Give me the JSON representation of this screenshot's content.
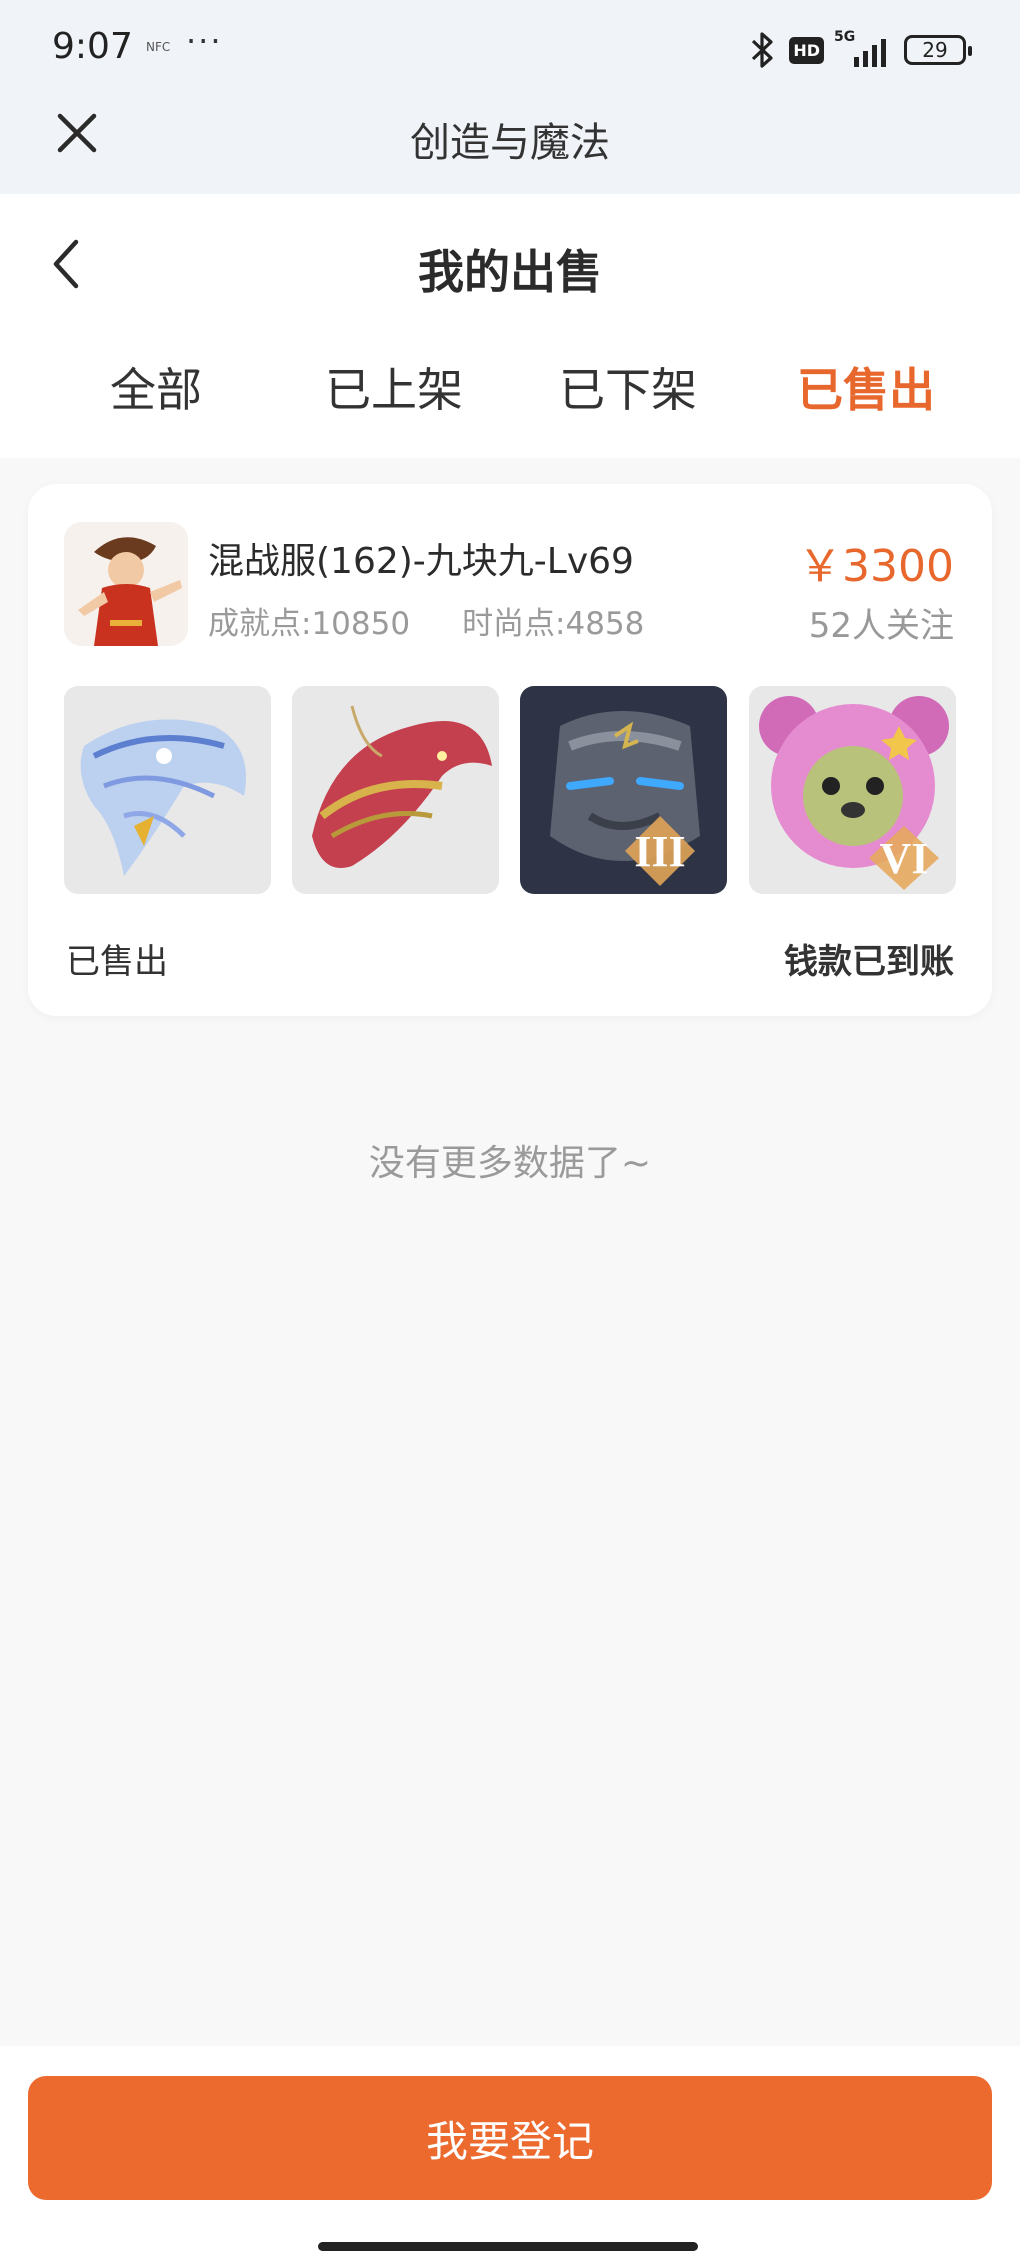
{
  "status_bar": {
    "time": "9:07",
    "small_icon_text": "NFC",
    "dots": "···",
    "hd": "HD",
    "network": "5G",
    "battery": "29"
  },
  "mini_header": {
    "title": "创造与魔法"
  },
  "page": {
    "title": "我的出售"
  },
  "tabs": [
    {
      "label": "全部",
      "active": false
    },
    {
      "label": "已上架",
      "active": false
    },
    {
      "label": "已下架",
      "active": false
    },
    {
      "label": "已售出",
      "active": true
    }
  ],
  "card": {
    "title": "混战服(162)-九块九-Lv69",
    "achievement": "成就点:10850",
    "fashion": "时尚点:4858",
    "price": "￥3300",
    "followers": "52人关注",
    "thumbnails": [
      {
        "name": "blue dragon mount",
        "badge": ""
      },
      {
        "name": "red-gold dragon mount",
        "badge": ""
      },
      {
        "name": "stone golem mount",
        "badge": "III"
      },
      {
        "name": "pink bear pet",
        "badge": "VI"
      }
    ],
    "status": "已售出",
    "payment_status": "钱款已到账"
  },
  "list_end_text": "没有更多数据了~",
  "action": {
    "register_label": "我要登记"
  },
  "colors": {
    "accent": "#ec6a2d",
    "active_tab": "#e8672c",
    "muted": "#9a9a9a"
  }
}
